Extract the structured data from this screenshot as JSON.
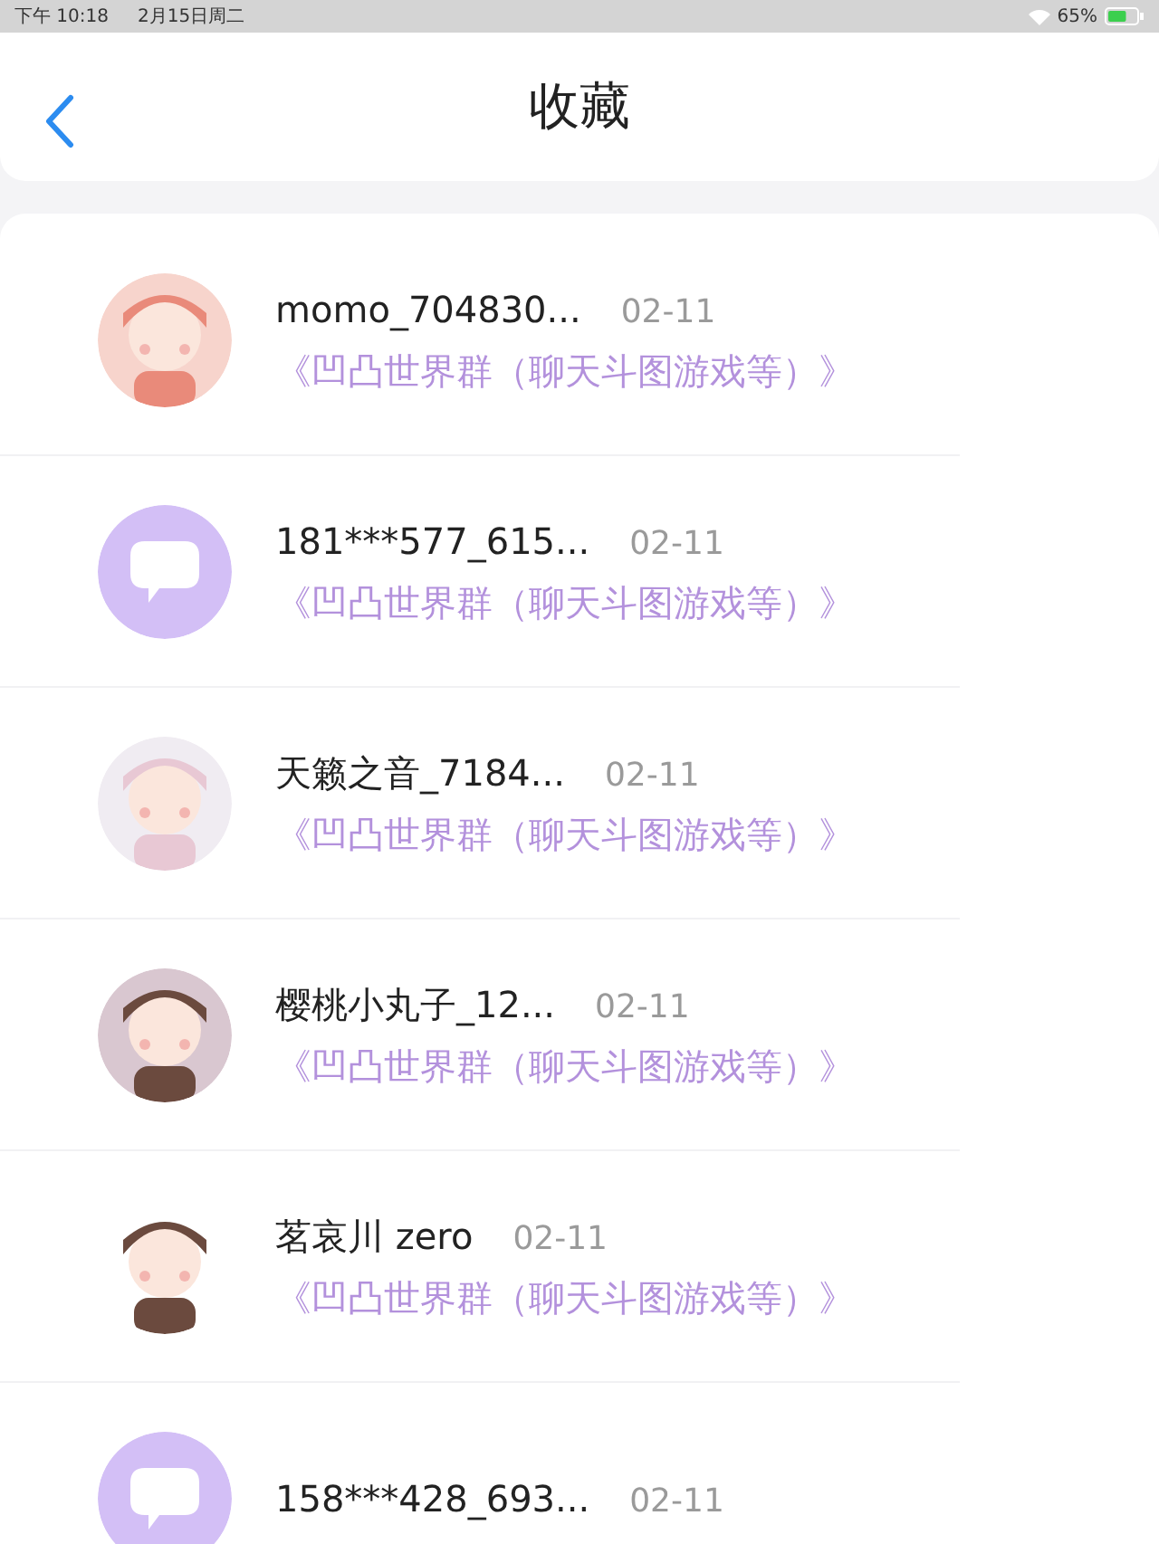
{
  "status_bar": {
    "time": "下午 10:18",
    "date": "2月15日周二",
    "battery": "65%"
  },
  "header": {
    "title": "收藏"
  },
  "items": [
    {
      "name": "momo_704830...",
      "date": "02-11",
      "group": "《凹凸世界群（聊天斗图游戏等）》"
    },
    {
      "avatar": {
        "kind": "bot"
      },
      "name": "181***577_615...",
      "date": "02-11",
      "group": "《凹凸世界群（聊天斗图游戏等）》"
    },
    {
      "name": "天籁之音_7184...",
      "date": "02-11",
      "group": "《凹凸世界群（聊天斗图游戏等）》"
    },
    {
      "name": "樱桃小丸子_12...",
      "date": "02-11",
      "group": "《凹凸世界群（聊天斗图游戏等）》"
    },
    {
      "name": "茗哀川 zero",
      "date": "02-11",
      "group": "《凹凸世界群（聊天斗图游戏等）》"
    },
    {
      "avatar": {
        "kind": "bot"
      },
      "name": "158***428_693...",
      "date": "02-11"
    }
  ]
}
